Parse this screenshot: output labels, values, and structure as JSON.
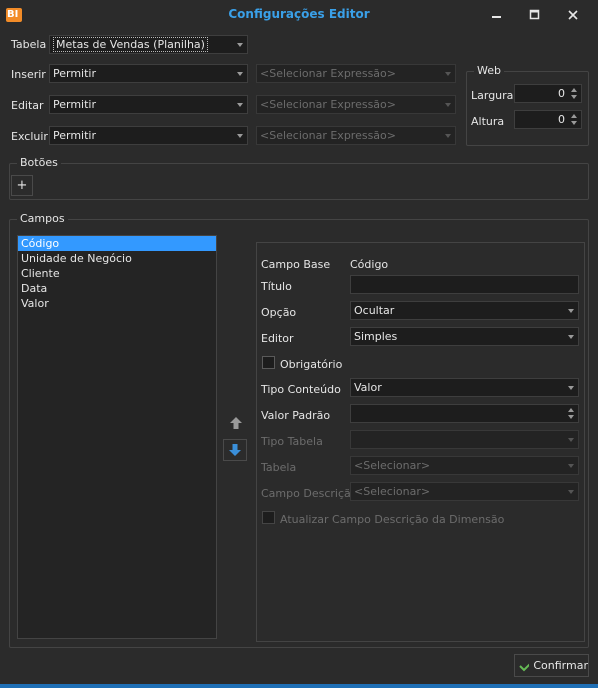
{
  "window": {
    "title": "Configurações Editor",
    "logo_text": "BI",
    "icons": [
      "minimize-icon",
      "maximize-icon",
      "close-icon"
    ]
  },
  "tabela": {
    "label": "Tabela",
    "value": "Metas de Vendas (Planilha)"
  },
  "permissions": [
    {
      "label": "Inserir",
      "value": "Permitir",
      "expression_placeholder": "<Selecionar Expressão>"
    },
    {
      "label": "Editar",
      "value": "Permitir",
      "expression_placeholder": "<Selecionar Expressão>"
    },
    {
      "label": "Excluir",
      "value": "Permitir",
      "expression_placeholder": "<Selecionar Expressão>"
    }
  ],
  "web": {
    "title": "Web",
    "largura_label": "Largura",
    "largura_value": "0",
    "altura_label": "Altura",
    "altura_value": "0"
  },
  "botoes": {
    "title": "Botões",
    "add_label": "+"
  },
  "campos": {
    "title": "Campos",
    "items": [
      "Código",
      "Unidade de Negócio",
      "Cliente",
      "Data",
      "Valor"
    ],
    "selected_index": 0
  },
  "detail": {
    "campo_base_label": "Campo Base",
    "campo_base_value": "Código",
    "titulo_label": "Título",
    "titulo_value": "",
    "opcao_label": "Opção",
    "opcao_value": "Ocultar",
    "editor_label": "Editor",
    "editor_value": "Simples",
    "obrigatorio_label": "Obrigatório",
    "tipo_conteudo_label": "Tipo Conteúdo",
    "tipo_conteudo_value": "Valor",
    "valor_padrao_label": "Valor Padrão",
    "valor_padrao_value": "",
    "tipo_tabela_label": "Tipo Tabela",
    "tipo_tabela_value": "",
    "tabela_label": "Tabela",
    "tabela_value": "<Selecionar>",
    "campo_descricao_label": "Campo Descrição",
    "campo_descricao_value": "<Selecionar>",
    "atualizar_label": "Atualizar Campo Descrição da Dimensão"
  },
  "footer": {
    "confirm_label": "Confirmar"
  },
  "colors": {
    "accent": "#3399ff",
    "title": "#3aa0e8",
    "logo": "#f28c28",
    "background": "#2b2b2b"
  }
}
